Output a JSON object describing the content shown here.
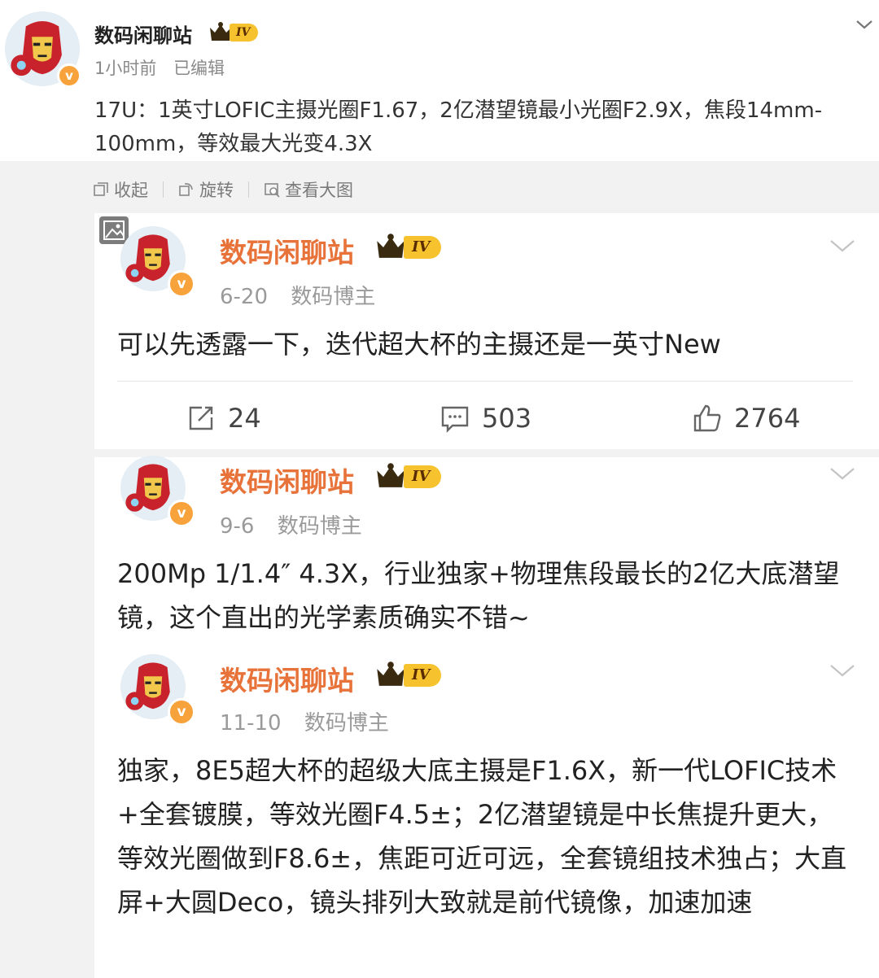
{
  "post": {
    "author": "数码闲聊站",
    "level": "IV",
    "verified_mark": "v",
    "time": "1小时前",
    "edited": "已编辑",
    "text": "17U：1英寸LOFIC主摄光圈F1.67，2亿潜望镜最小光圈F2.9X，焦段14mm-100mm，等效最大光变4.3X"
  },
  "toolbar": {
    "collapse": "收起",
    "rotate": "旋转",
    "view_large": "查看大图"
  },
  "comments": [
    {
      "author": "数码闲聊站",
      "level": "IV",
      "date": "6-20",
      "role": "数码博主",
      "text": "可以先透露一下，迭代超大杯的主摄还是一英寸New",
      "reposts": "24",
      "comments": "503",
      "likes": "2764"
    },
    {
      "author": "数码闲聊站",
      "level": "IV",
      "date": "9-6",
      "role": "数码博主",
      "text": "200Mp 1/1.4″ 4.3X，行业独家+物理焦段最长的2亿大底潜望镜，这个直出的光学素质确实不错~"
    },
    {
      "author": "数码闲聊站",
      "level": "IV",
      "date": "11-10",
      "role": "数码博主",
      "text": "独家，8E5超大杯的超级大底主摄是F1.6X，新一代LOFIC技术+全套镀膜，等效光圈F4.5±；2亿潜望镜是中长焦提升更大，等效光圈做到F8.6±，焦距可近可远，全套镜组技术独占；大直屏+大圆Deco，镜头排列大致就是前代镜像，加速加速"
    }
  ],
  "colors": {
    "accent_name": "#e8733a",
    "badge_orange": "#f7a23a",
    "level_gold": "#f6c22d"
  }
}
